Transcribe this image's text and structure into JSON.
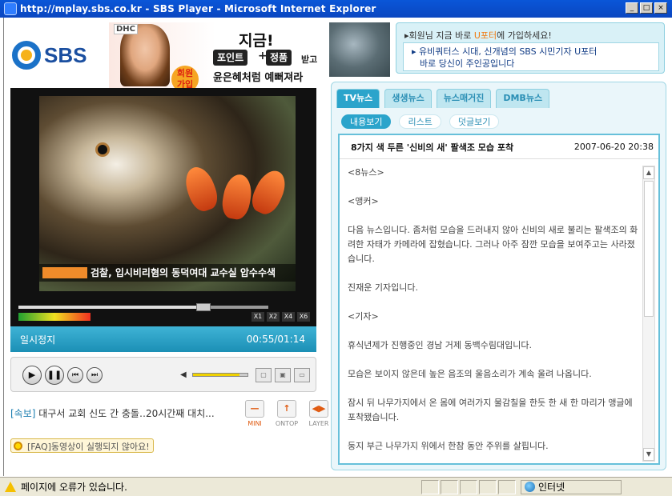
{
  "window": {
    "title": "http://mplay.sbs.co.kr - SBS Player - Microsoft Internet Explorer",
    "controls": [
      "_",
      "□",
      "×"
    ]
  },
  "logo": {
    "text": "SBS"
  },
  "ad": {
    "brand": "DHC",
    "headline": "지금!",
    "badge": "회원 가입",
    "pill1": "포인트",
    "plus": "+",
    "pill2": "정품",
    "after": "받고",
    "subline": "윤은혜처럼 예뻐져라"
  },
  "player": {
    "caption": "검찰, 입시비리혐의 동덕여대 교수실 압수수색",
    "speeds": [
      "X1",
      "X2",
      "X4",
      "X6"
    ],
    "state": "일시정지",
    "time": "00:55/01:14",
    "progress": 0.74,
    "volume": 0.85
  },
  "ticker": {
    "tag": "[속보]",
    "text": "대구서 교회 신도 간 충돌‥20시간째 대치..."
  },
  "side_buttons": [
    {
      "label": "MINI"
    },
    {
      "label": "ONTOP"
    },
    {
      "label": "LAYER"
    }
  ],
  "faq": {
    "text": "[FAQ]동영상이 실행되지 않아요!"
  },
  "promo": {
    "line1_prefix": "▸회원님 지금 바로 ",
    "line1_highlight": "U포터",
    "line1_suffix": "에 가입하세요!",
    "line2": "▸ 유비쿼터스 시대, 신개념의 SBS 시민기자 U포터",
    "line3": "바로 당신이 주인공입니다"
  },
  "tabs": [
    "TV뉴스",
    "생생뉴스",
    "뉴스매거진",
    "DMB뉴스"
  ],
  "subtabs": [
    "내용보기",
    "리스트",
    "덧글보기"
  ],
  "article": {
    "title": "8가지 색 두른 '신비의 새' 팔색조 모습 포착",
    "date": "2007-06-20 20:38",
    "paragraphs": [
      "<8뉴스>",
      "<앵커>",
      "다음 뉴스입니다. 좀처럼 모습을 드러내지 않아 신비의 새로 불리는 팔색조의 화려한 자태가 카메라에 잡혔습니다. 그러나 아주 잠깐 모습을 보여주고는 사라졌습니다.",
      "진재운 기자입니다.",
      "<기자>",
      "휴식년제가 진행중인 경남 거제 동백수림대입니다.",
      "모습은 보이지 않은데 높은 음조의 울음소리가 계속 울려 나옵니다.",
      "잠시 뒤 나무가지에서 온 몸에 여러가지 물감칠을 한듯 한 새 한 마리가 앵글에 포착됐습니다.",
      "둥지 부근 나무가지 위에서 한참 동안 주위를 살핍니다."
    ]
  },
  "statusbar": {
    "message": "페이지에 오류가 있습니다.",
    "zone": "인터넷"
  }
}
